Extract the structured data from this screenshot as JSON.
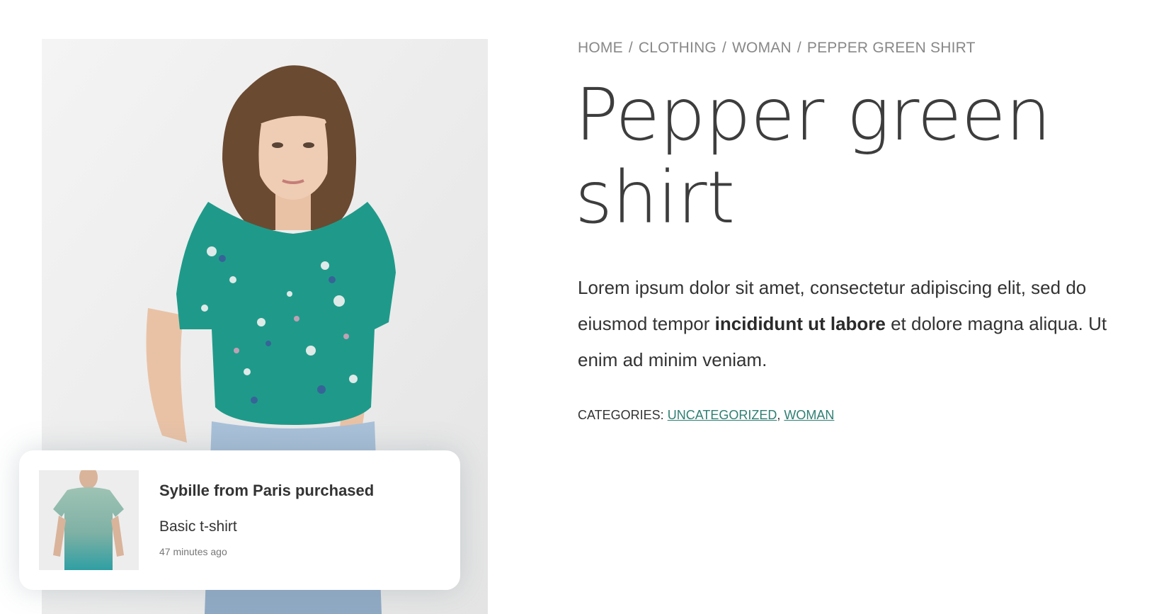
{
  "breadcrumb": {
    "items": [
      "HOME",
      "CLOTHING",
      "WOMAN"
    ],
    "current": "PEPPER GREEN SHIRT",
    "separator": "/"
  },
  "product": {
    "title_line1": "Pepper green",
    "title_line2": "shirt",
    "description": {
      "part1": "Lorem ipsum dolor sit amet, consectetur adipiscing elit, sed do eiusmod tempor ",
      "bold": "incididunt ut labore",
      "part2": " et dolore magna aliqua. Ut enim ad minim veniam."
    },
    "categories": {
      "label": "CATEGORIES:",
      "items": [
        "UNCATEGORIZED",
        "WOMAN"
      ],
      "separator": ","
    },
    "image_icon": "product-photo-woman-floral-shirt"
  },
  "notification": {
    "title": "Sybille from Paris purchased",
    "product": "Basic t-shirt",
    "time": "47 minutes ago",
    "image_icon": "product-photo-basic-tshirt"
  },
  "colors": {
    "link": "#2f7f73",
    "shirt": "#1f9a8a",
    "text": "#333333",
    "muted": "#888888"
  }
}
